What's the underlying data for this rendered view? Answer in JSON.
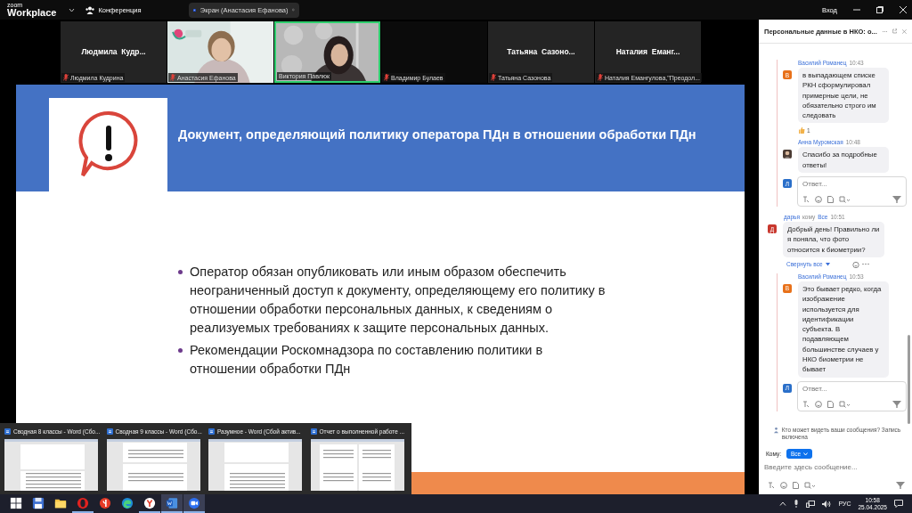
{
  "top_bar": {
    "brand_small": "zoom",
    "brand": "Workplace",
    "meeting_menu": "Конференция",
    "share_indicator": "Экран (Анастасия Ефанова)",
    "sign_in": "Вход"
  },
  "gallery": [
    {
      "kind": "name",
      "display_name": "Людмила  Кудр...",
      "label": "Людмила Кудрина",
      "muted": true,
      "speaking": false
    },
    {
      "kind": "video",
      "label": "Анастасия Ефанова",
      "muted": true,
      "speaking": false
    },
    {
      "kind": "video",
      "label": "Виктория Павлюк",
      "muted": false,
      "speaking": true
    },
    {
      "kind": "blank",
      "label": "Владимир Булаев",
      "muted": true,
      "speaking": false
    },
    {
      "kind": "name",
      "display_name": "Татьяна  Сазоно...",
      "label": "Татьяна Сазонова",
      "muted": true,
      "speaking": false
    },
    {
      "kind": "name",
      "display_name": "Наталия  Еманг...",
      "label": "Наталия Емангулова,\"Преодол...",
      "muted": true,
      "speaking": false
    }
  ],
  "slide": {
    "title": "Документ, определяющий политику оператора ПДн в отношении обработки ПДн",
    "bullets": [
      "Оператор обязан опубликовать или иным образом обеспечить неограниченный доступ к документу, определяющему его политику в отношении обработки персональных данных, к сведениям о реализуемых требованиях к защите персональных данных.",
      "Рекомендации Роскомнадзора по составлению политики в отношении обработки ПДн"
    ]
  },
  "window_previews": [
    "Сводная 8 классы - Word (Сбо...",
    "Сводная 9 классы - Word (Сбо...",
    "Разумное - Word (Сбой актив...",
    "Отчет о выполненной работе ..."
  ],
  "chat": {
    "title": "Персональные данные в НКО: о...",
    "messages": [
      {
        "kind": "thread",
        "items": [
          {
            "author": "Василий Романец",
            "time": "10:43",
            "avatar": "В",
            "color": "#e8711a",
            "text": "в выпадающем списке РКН сформулировал примерные цели, не обязательно строго им следовать",
            "reaction_count": "1"
          },
          {
            "author": "Анна Муромская",
            "time": "10:48",
            "text": "Спасибо за подробные ответы!"
          }
        ],
        "reply_avatar": "Л",
        "reply_placeholder": "Ответ..."
      },
      {
        "kind": "message",
        "author": "дарья",
        "recipient_prefix": "кому",
        "recipient": "Все",
        "time": "10:51",
        "avatar": "Д",
        "color": "#c8372d",
        "text": "Добрый день! Правильно ли я поняла, что фото относится к биометрии?",
        "collapse_label": "Свернуть все"
      },
      {
        "kind": "thread",
        "items": [
          {
            "author": "Василий Романец",
            "time": "10:53",
            "avatar": "В",
            "color": "#e8711a",
            "text": "Это бывает редко, когда изображение используется для идентификации субъекта. В подавляющем большинстве случаев у НКО биометрии не бывает"
          }
        ],
        "reply_avatar": "Л",
        "reply_placeholder": "Ответ..."
      }
    ],
    "notice": "Кто может видеть ваши сообщения? Запись включена",
    "to_label": "Кому:",
    "to_value": "Все",
    "input_placeholder": "Введите здесь сообщение..."
  },
  "taskbar": {
    "apps": [
      {
        "kind": "start",
        "running": false,
        "active": false
      },
      {
        "kind": "save",
        "running": false,
        "active": false
      },
      {
        "kind": "folder",
        "running": false,
        "active": false
      },
      {
        "kind": "opera",
        "running": true,
        "active": false
      },
      {
        "kind": "yandex",
        "running": false,
        "active": false
      },
      {
        "kind": "edge",
        "running": false,
        "active": false
      },
      {
        "kind": "yabrowser",
        "running": true,
        "active": false
      },
      {
        "kind": "word",
        "running": true,
        "active": true
      },
      {
        "kind": "zoom",
        "running": true,
        "active": true
      }
    ],
    "language": "РУС",
    "time": "10:58",
    "date": "25.04.2025"
  }
}
